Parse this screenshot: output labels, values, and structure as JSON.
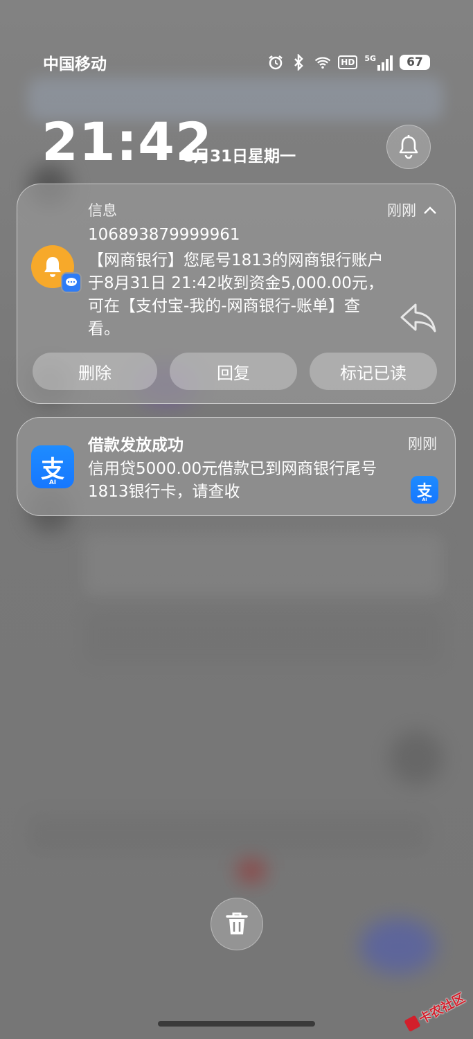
{
  "status_bar": {
    "carrier": "中国移动",
    "hd_label": "HD",
    "network_label": "5G",
    "battery": "67",
    "icons": [
      "alarm-icon",
      "bluetooth-icon",
      "wifi-icon",
      "signal-icon"
    ]
  },
  "lockscreen": {
    "time": "21:42",
    "date": "8月31日星期一"
  },
  "notifications": [
    {
      "app": "信息",
      "time": "刚刚",
      "sender": "106893879999961",
      "body": "【网商银行】您尾号1813的网商银行账户于8月31日 21:42收到资金5,000.00元，可在【支付宝-我的-网商银行-账单】查看。",
      "actions": [
        "删除",
        "回复",
        "标记已读"
      ],
      "icon": "bell-icon",
      "accent": "#f7a92a"
    },
    {
      "app_icon_label": "支",
      "ai_label": "AI",
      "title": "借款发放成功",
      "time": "刚刚",
      "body": "信用贷5000.00元借款已到网商银行尾号1813银行卡，请查收",
      "accent": "#1677ff"
    }
  ],
  "watermark": "卡农社区"
}
